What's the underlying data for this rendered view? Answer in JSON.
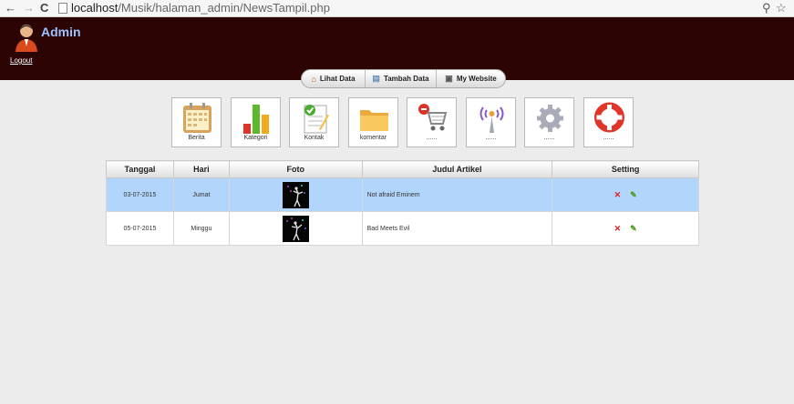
{
  "browser": {
    "url_host": "localhost",
    "url_path": "/Musik/halaman_admin/NewsTampil.php"
  },
  "header": {
    "title": "Admin",
    "logout_label": "Logout"
  },
  "tabs": [
    {
      "label": "Lihat Data",
      "icon": "home-icon"
    },
    {
      "label": "Tambah Data",
      "icon": "document-icon"
    },
    {
      "label": "My Website",
      "icon": "website-icon"
    }
  ],
  "shortcuts": [
    {
      "label": "Berita",
      "icon": "calendar-icon"
    },
    {
      "label": "Kategori",
      "icon": "bar-chart-icon"
    },
    {
      "label": "Kontak",
      "icon": "checklist-icon"
    },
    {
      "label": "komentar",
      "icon": "folder-icon"
    },
    {
      "label": "......",
      "icon": "cart-icon"
    },
    {
      "label": "......",
      "icon": "broadcast-icon"
    },
    {
      "label": "......",
      "icon": "gear-icon"
    },
    {
      "label": "......",
      "icon": "lifebuoy-icon"
    }
  ],
  "table": {
    "headers": [
      "Tanggal",
      "Hari",
      "Foto",
      "Judul Artikel",
      "Setting"
    ],
    "rows": [
      {
        "date": "03-07-2015",
        "day": "Jumat",
        "title": "Not afraid Eminem",
        "selected": true
      },
      {
        "date": "05-07-2015",
        "day": "Minggu",
        "title": "Bad Meets Evil",
        "selected": false
      }
    ],
    "delete_label": "✕",
    "edit_label": "✎"
  },
  "colors": {
    "header_bg": "#2c0404",
    "title": "#9cc3ff",
    "selected_row": "#b2d6fb"
  }
}
